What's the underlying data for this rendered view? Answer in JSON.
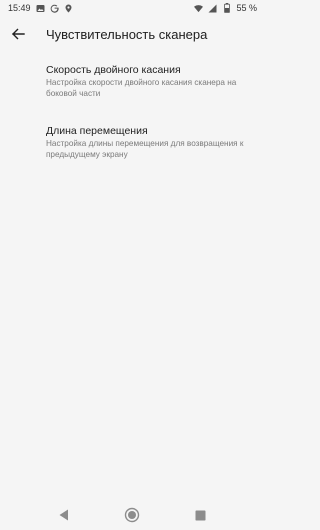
{
  "status_bar": {
    "time": "15:49",
    "left_icons": [
      "image-icon",
      "google-icon",
      "location-icon"
    ],
    "right_icons": [
      "wifi-icon",
      "signal-icon",
      "battery-icon"
    ],
    "battery": "55 %"
  },
  "app_bar": {
    "title": "Чувствительность сканера"
  },
  "settings": [
    {
      "title": "Скорость двойного касания",
      "summary": "Настройка скорости двойного касания сканера на боковой части"
    },
    {
      "title": "Длина перемещения",
      "summary": "Настройка длины перемещения для возвращения к предыдущему экрану"
    }
  ],
  "nav_bar": {
    "buttons": [
      "back-icon",
      "home-icon",
      "recents-icon"
    ]
  },
  "colors": {
    "background": "#f5f5f5",
    "text_primary": "#222222",
    "text_secondary": "#7a7a7a",
    "nav_icons": "#8c8c8c"
  }
}
